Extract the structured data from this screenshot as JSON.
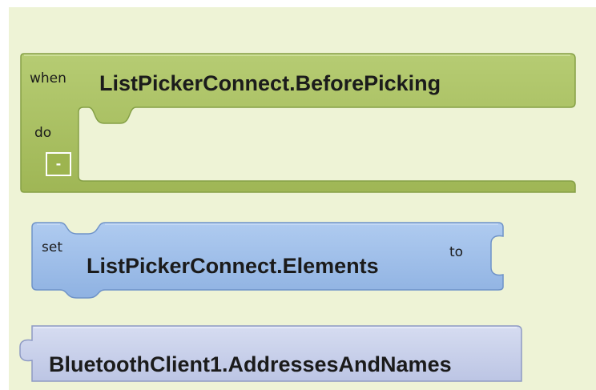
{
  "event_block": {
    "keyword": "when",
    "event_name": "ListPickerConnect.BeforePicking",
    "do_label": "do",
    "collapse_symbol": "-",
    "color": "#a6bf5e"
  },
  "setter_block": {
    "keyword": "set",
    "property_name": "ListPickerConnect.Elements",
    "to_label": "to",
    "color": "#9ebde8"
  },
  "getter_block": {
    "property_name": "BluetoothClient1.AddressesAndNames",
    "color": "#c7cfe8"
  },
  "workspace": {
    "background_color": "#eef3d6"
  }
}
